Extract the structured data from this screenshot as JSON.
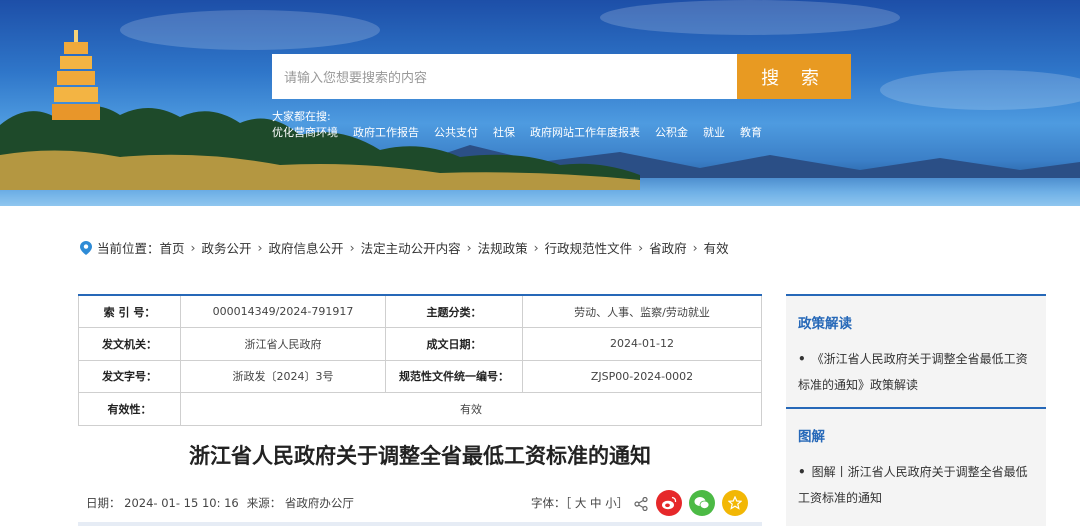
{
  "search": {
    "placeholder": "请输入您想要搜索的内容",
    "button_label": "搜 索",
    "hot_label": "大家都在搜:",
    "hot_links": [
      "优化营商环境",
      "政府工作报告",
      "公共支付",
      "社保",
      "政府网站工作年度报表",
      "公积金",
      "就业",
      "教育"
    ]
  },
  "breadcrumb": {
    "prefix": "当前位置：",
    "items": [
      "首页",
      "政务公开",
      "政府信息公开",
      "法定主动公开内容",
      "法规政策",
      "行政规范性文件",
      "省政府",
      "有效"
    ]
  },
  "info_table": {
    "index_label": "索 引 号：",
    "index_value": "000014349/2024-791917",
    "topic_label": "主题分类：",
    "topic_value": "劳动、人事、监察/劳动就业",
    "issuer_label": "发文机关：",
    "issuer_value": "浙江省人民政府",
    "date_label": "成文日期：",
    "date_value": "2024-01-12",
    "docno_label": "发文字号：",
    "docno_value": "浙政发〔2024〕3号",
    "uniform_label": "规范性文件统一编号：",
    "uniform_value": "ZJSP00-2024-0002",
    "validity_label": "有效性：",
    "validity_value": "有效"
  },
  "document": {
    "title": "浙江省人民政府关于调整全省最低工资标准的通知",
    "date_text": "日期：  2024- 01- 15 10: 16",
    "source_text": "来源：  省政府办公厅",
    "font_size_text": "字体：［ 大  中  小］"
  },
  "sidebar": {
    "policy_title": "政策解读",
    "policy_item": "《浙江省人民政府关于调整全省最低工资标准的通知》政策解读",
    "graphic_title": "图解",
    "graphic_item": "图解丨浙江省人民政府关于调整全省最低工资标准的通知"
  },
  "colors": {
    "accent_blue": "#2668b8",
    "search_button": "#e89a22",
    "weibo_red": "#e6282a",
    "wechat_green": "#4cba45",
    "favorite_yellow": "#f2b705"
  },
  "icons": {
    "breadcrumb": "location-pin-icon",
    "share": "share-icon",
    "weibo": "weibo-icon",
    "wechat": "wechat-icon",
    "favorite": "star-icon"
  }
}
